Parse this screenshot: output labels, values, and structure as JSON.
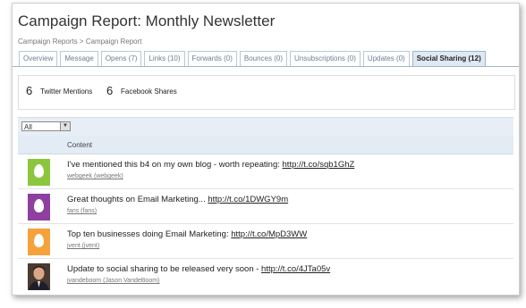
{
  "page": {
    "title": "Campaign Report: Monthly Newsletter",
    "breadcrumb": "Campaign Reports > Campaign Report"
  },
  "tabs": [
    {
      "label": "Overview"
    },
    {
      "label": "Message"
    },
    {
      "label": "Opens (7)"
    },
    {
      "label": "Links (10)"
    },
    {
      "label": "Forwards (0)"
    },
    {
      "label": "Bounces (0)"
    },
    {
      "label": "Unsubscriptions (0)"
    },
    {
      "label": "Updates (0)"
    },
    {
      "label": "Social Sharing (12)"
    }
  ],
  "stats": {
    "twitter_count": "6",
    "twitter_label": "Twitter Mentions",
    "facebook_count": "6",
    "facebook_label": "Facebook Shares"
  },
  "filter": {
    "selected": "All"
  },
  "table": {
    "column_header": "Content"
  },
  "rows": [
    {
      "text": "I've mentioned this b4 on my own blog - worth repeating: ",
      "link": "http://t.co/sqb1GhZ",
      "user": "webgeek (webgeek)",
      "avatar_color": "#8cc63f",
      "avatar": "egg-icon"
    },
    {
      "text": "Great thoughts on Email Marketing... ",
      "link": "http://t.co/1DWGY9m",
      "user": "fans (fans)",
      "avatar_color": "#8e3fa0",
      "avatar": "egg-icon"
    },
    {
      "text": "Top ten businesses doing Email Marketing: ",
      "link": "http://t.co/MpD3WW",
      "user": "jvent (jvent)",
      "avatar_color": "#f5a23c",
      "avatar": "egg-icon"
    },
    {
      "text": "Update to social sharing to be released very soon - ",
      "link": "http://t.co/4JTa05v",
      "user": "jvandeboom (Jason VandeBoom)",
      "avatar": "person-photo"
    }
  ]
}
